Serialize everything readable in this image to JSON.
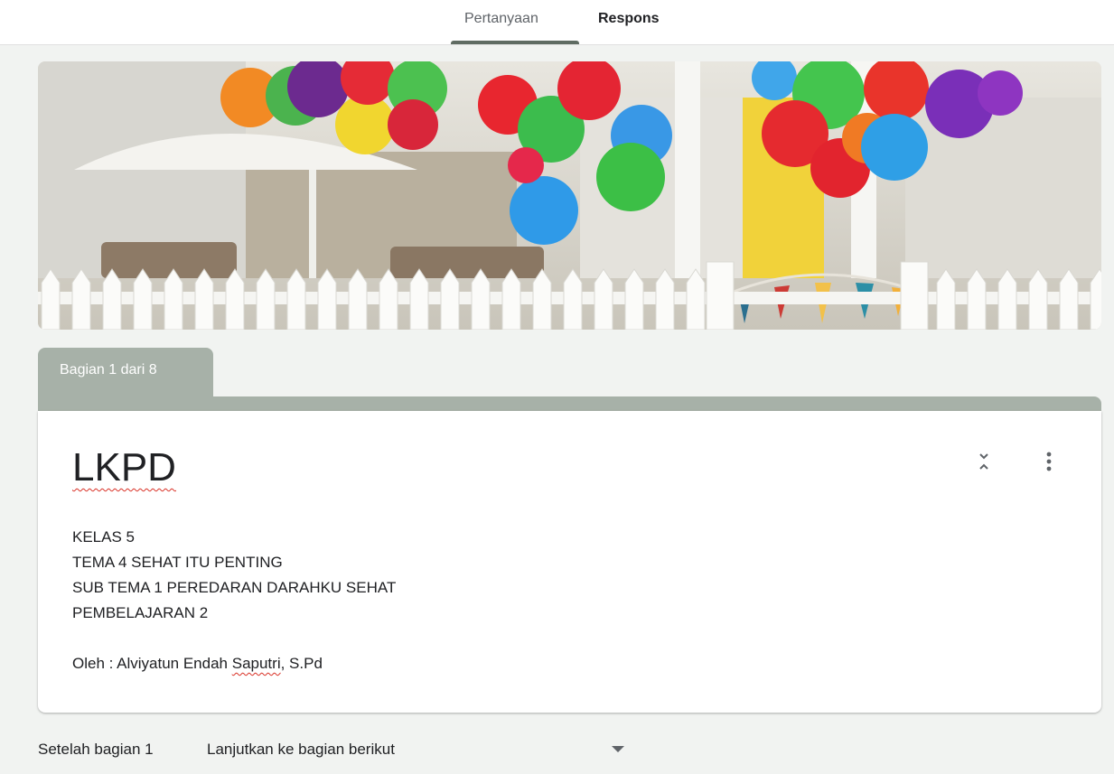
{
  "tabs": {
    "questions": "Pertanyaan",
    "responses": "Respons"
  },
  "section": {
    "label": "Bagian 1 dari 8"
  },
  "form": {
    "title": "LKPD",
    "description": {
      "lines": [
        "KELAS 5",
        "TEMA 4 SEHAT ITU PENTING",
        "SUB TEMA 1 PEREDARAN DARAHKU SEHAT",
        "PEMBELAJARAN 2"
      ],
      "author_prefix": "Oleh : Alviyatun Endah ",
      "author_spell": "Saputri",
      "author_suffix": ", S.Pd"
    }
  },
  "after_section": {
    "label": "Setelah bagian 1",
    "value": "Lanjutkan ke bagian berikut"
  },
  "icons": {
    "collapse": "collapse-icon",
    "more": "more-vert-icon",
    "dropdown": "arrow-drop-down-icon"
  },
  "colors": {
    "section_accent": "#a7b1a8",
    "tab_underline": "#5f6b62",
    "spellcheck": "#d93025"
  }
}
